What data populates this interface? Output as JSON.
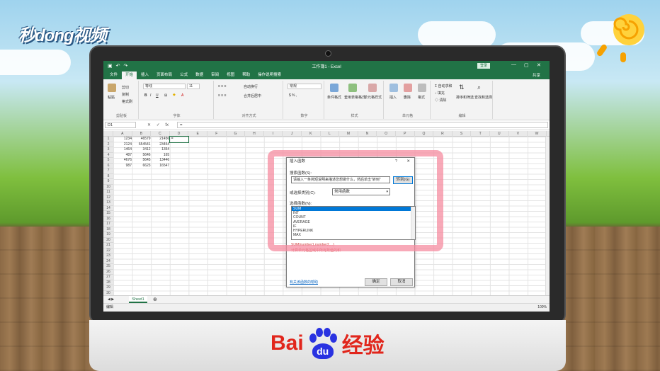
{
  "watermark": {
    "brand": "秒dong视频",
    "footer_brand_latin": "Bai",
    "footer_brand_du": "du",
    "footer_brand_cn": "经验"
  },
  "window": {
    "title": "工作簿1 - Excel",
    "login_label": "登录",
    "share_label": "共享"
  },
  "tabs": [
    "文件",
    "开始",
    "插入",
    "页面布局",
    "公式",
    "数据",
    "审阅",
    "视图",
    "帮助",
    "操作说明搜索"
  ],
  "active_tab": "开始",
  "ribbon": {
    "clipboard": {
      "paste": "粘贴",
      "cut": "剪切",
      "copy": "复制",
      "format_painter": "格式刷",
      "label": "剪贴板"
    },
    "font": {
      "name": "等线",
      "size": "11",
      "label": "字体"
    },
    "alignment": {
      "wrap": "自动换行",
      "merge": "合并后居中",
      "label": "对齐方式"
    },
    "number": {
      "format": "常规",
      "label": "数字"
    },
    "styles": {
      "conditional": "条件格式",
      "table": "套用表格格式",
      "cell": "单元格样式",
      "label": "样式"
    },
    "cells": {
      "insert": "插入",
      "delete": "删除",
      "format": "格式",
      "label": "单元格"
    },
    "editing": {
      "autosum": "自动求和",
      "fill": "填充",
      "clear": "清除",
      "sort": "排序和筛选",
      "find": "查找和选择",
      "label": "编辑"
    }
  },
  "formula_bar": {
    "name_box": "D1",
    "icons": "✕ ✓ fx",
    "content": "="
  },
  "columns": [
    "A",
    "B",
    "C",
    "D",
    "E",
    "F",
    "G",
    "H",
    "I",
    "J",
    "K",
    "L",
    "M",
    "N",
    "O",
    "P",
    "Q",
    "R",
    "S",
    "T",
    "U",
    "V",
    "W"
  ],
  "rows": [
    "1",
    "2",
    "3",
    "4",
    "5",
    "6",
    "7",
    "8",
    "9",
    "10",
    "11",
    "12",
    "13",
    "14",
    "15",
    "16",
    "17",
    "18",
    "19",
    "20",
    "21",
    "22",
    "23",
    "24",
    "25",
    "26",
    "27",
    "28",
    "29",
    "30"
  ],
  "cells": [
    [
      "1234",
      "46579",
      "21456",
      "="
    ],
    [
      "2124",
      "654541",
      "23454",
      ""
    ],
    [
      "1464",
      "3412",
      "1354",
      ""
    ],
    [
      "487",
      "5646",
      "165",
      ""
    ],
    [
      "4676",
      "5645",
      "13446",
      ""
    ],
    [
      "987",
      "6623",
      "16547",
      ""
    ]
  ],
  "sheet": {
    "tab": "Sheet1",
    "status": "编辑",
    "zoom": "100%"
  },
  "dialog": {
    "title": "插入函数",
    "help": "?",
    "close": "✕",
    "search_label": "搜索函数(S):",
    "search_value": "请输入一条简短说明来描述您想做什么，然后单击\"转到\"",
    "go_button": "转到(G)",
    "category_label": "或选择类别(C):",
    "category_value": "常用函数",
    "select_label": "选择函数(N):",
    "functions": [
      "SUM",
      "INT",
      "COUNT",
      "AVERAGE",
      "IF",
      "HYPERLINK",
      "MAX"
    ],
    "selected_function": "SUM",
    "signature": "SUM(number1,number2,...)",
    "description": "计算单元格区域中所有数值的和",
    "help_link": "有关该函数的帮助",
    "ok": "确定",
    "cancel": "取消"
  }
}
